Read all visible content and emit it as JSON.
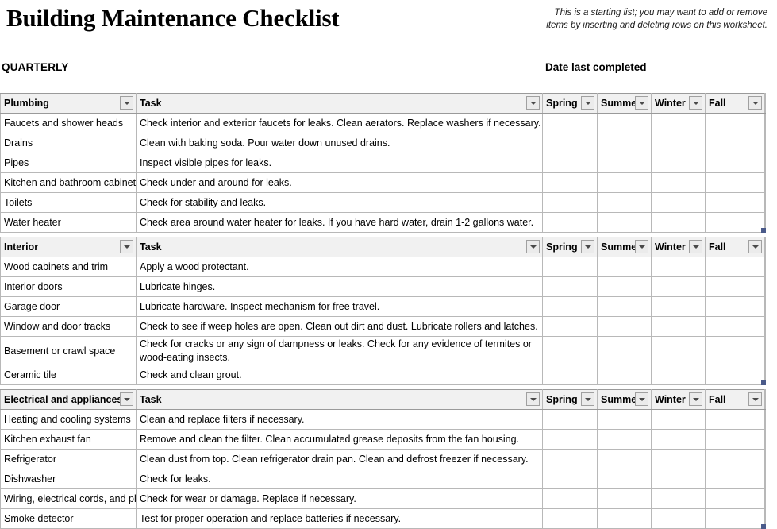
{
  "header": {
    "title": "Building Maintenance Checklist",
    "note": "This is a starting list; you may want to add or remove items by inserting and deleting rows on this worksheet.",
    "section_label": "QUARTERLY",
    "date_label": "Date last completed"
  },
  "columns": {
    "task": "Task",
    "spring": "Spring",
    "summer": "Summer",
    "winter": "Winter",
    "fall": "Fall"
  },
  "icons": {
    "filter": "filter-dropdown-icon"
  },
  "sections": [
    {
      "header": "Plumbing",
      "rows": [
        {
          "item": "Faucets and shower heads",
          "task": "Check interior and exterior faucets for leaks. Clean aerators. Replace washers if necessary.",
          "spring": "",
          "summer": "",
          "winter": "",
          "fall": "",
          "wrap": false
        },
        {
          "item": "Drains",
          "task": "Clean with baking soda. Pour water down unused drains.",
          "spring": "",
          "summer": "",
          "winter": "",
          "fall": "",
          "wrap": false
        },
        {
          "item": "Pipes",
          "task": "Inspect visible pipes for leaks.",
          "spring": "",
          "summer": "",
          "winter": "",
          "fall": "",
          "wrap": false
        },
        {
          "item": "Kitchen and bathroom cabinets",
          "task": "Check under and around for leaks.",
          "spring": "",
          "summer": "",
          "winter": "",
          "fall": "",
          "wrap": false
        },
        {
          "item": "Toilets",
          "task": "Check for stability and leaks.",
          "spring": "",
          "summer": "",
          "winter": "",
          "fall": "",
          "wrap": false
        },
        {
          "item": "Water heater",
          "task": "Check area around water heater for leaks. If you have hard water, drain 1-2 gallons water.",
          "spring": "",
          "summer": "",
          "winter": "",
          "fall": "",
          "wrap": false
        }
      ]
    },
    {
      "header": "Interior",
      "rows": [
        {
          "item": "Wood cabinets and trim",
          "task": "Apply a wood protectant.",
          "spring": "",
          "summer": "",
          "winter": "",
          "fall": "",
          "wrap": false
        },
        {
          "item": "Interior doors",
          "task": "Lubricate hinges.",
          "spring": "",
          "summer": "",
          "winter": "",
          "fall": "",
          "wrap": false
        },
        {
          "item": "Garage door",
          "task": "Lubricate hardware. Inspect mechanism for free travel.",
          "spring": "",
          "summer": "",
          "winter": "",
          "fall": "",
          "wrap": false
        },
        {
          "item": "Window and door tracks",
          "task": "Check to see if weep holes are open. Clean out dirt and dust. Lubricate rollers and latches.",
          "spring": "",
          "summer": "",
          "winter": "",
          "fall": "",
          "wrap": false
        },
        {
          "item": "Basement or crawl space",
          "task": "Check for cracks or any sign of dampness or leaks. Check for any evidence of termites or wood-eating insects.",
          "spring": "",
          "summer": "",
          "winter": "",
          "fall": "",
          "wrap": true
        },
        {
          "item": "Ceramic tile",
          "task": "Check and clean grout.",
          "spring": "",
          "summer": "",
          "winter": "",
          "fall": "",
          "wrap": false
        }
      ]
    },
    {
      "header": "Electrical and appliances",
      "rows": [
        {
          "item": "Heating and cooling systems",
          "task": "Clean and replace filters if necessary.",
          "spring": "",
          "summer": "",
          "winter": "",
          "fall": "",
          "wrap": false
        },
        {
          "item": "Kitchen exhaust fan",
          "task": "Remove and clean the filter. Clean accumulated grease deposits from the fan housing.",
          "spring": "",
          "summer": "",
          "winter": "",
          "fall": "",
          "wrap": false
        },
        {
          "item": "Refrigerator",
          "task": "Clean dust from top. Clean refrigerator drain pan. Clean and defrost freezer if necessary.",
          "spring": "",
          "summer": "",
          "winter": "",
          "fall": "",
          "wrap": false
        },
        {
          "item": "Dishwasher",
          "task": "Check for leaks.",
          "spring": "",
          "summer": "",
          "winter": "",
          "fall": "",
          "wrap": false
        },
        {
          "item": "Wiring, electrical cords, and plugs",
          "task": "Check for wear or damage. Replace if necessary.",
          "spring": "",
          "summer": "",
          "winter": "",
          "fall": "",
          "wrap": false
        },
        {
          "item": "Smoke detector",
          "task": "Test for proper operation and replace batteries if necessary.",
          "spring": "",
          "summer": "",
          "winter": "",
          "fall": "",
          "wrap": false
        }
      ]
    }
  ]
}
